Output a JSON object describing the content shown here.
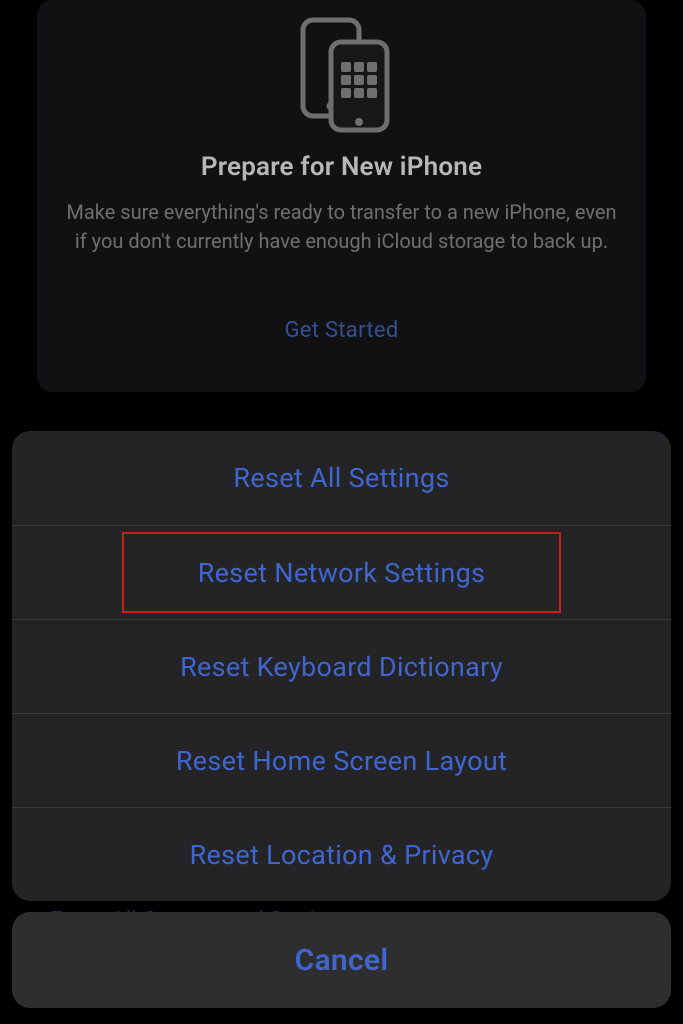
{
  "colors": {
    "accent": "#3f66cf",
    "highlight_border": "#d01a1a",
    "sheet_bg": "#242426",
    "cancel_bg": "#2e2e30"
  },
  "prepare_card": {
    "title": "Prepare for New iPhone",
    "description": "Make sure everything's ready to transfer to a new iPhone, even if you don't currently have enough iCloud storage to back up.",
    "cta": "Get Started",
    "icon": "two-iphones-icon"
  },
  "peek_row": {
    "label": "Erase All Content and Settings"
  },
  "action_sheet": {
    "items": [
      {
        "label": "Reset All Settings",
        "highlighted": false
      },
      {
        "label": "Reset Network Settings",
        "highlighted": true
      },
      {
        "label": "Reset Keyboard Dictionary",
        "highlighted": false
      },
      {
        "label": "Reset Home Screen Layout",
        "highlighted": false
      },
      {
        "label": "Reset Location & Privacy",
        "highlighted": false
      }
    ]
  },
  "cancel": {
    "label": "Cancel"
  }
}
